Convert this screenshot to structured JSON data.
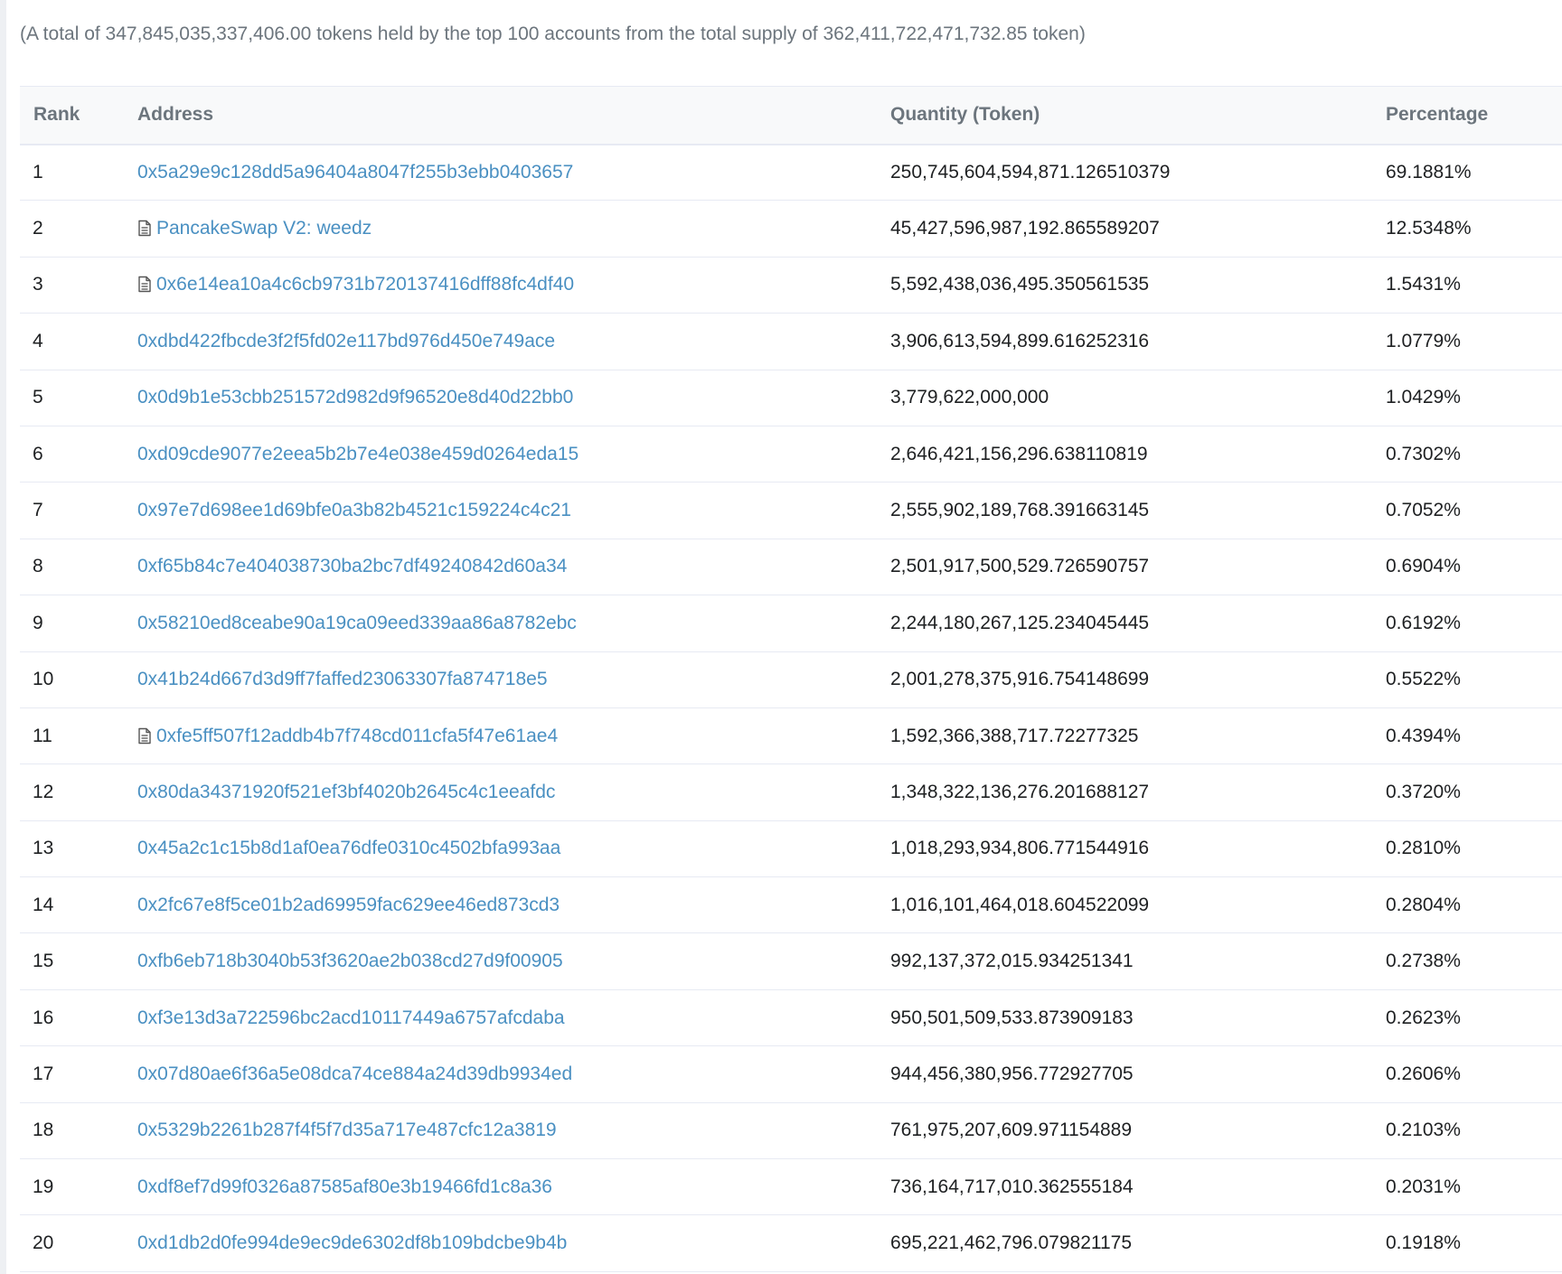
{
  "summary": {
    "text": "(A total of 347,845,035,337,406.00 tokens held by the top 100 accounts from the total supply of 362,411,722,471,732.85 token)"
  },
  "table": {
    "headers": {
      "rank": "Rank",
      "address": "Address",
      "quantity": "Quantity (Token)",
      "percentage": "Percentage"
    },
    "rows": [
      {
        "rank": "1",
        "address": "0x5a29e9c128dd5a96404a8047f255b3ebb0403657",
        "contract": false,
        "quantity": "250,745,604,594,871.126510379",
        "percentage": "69.1881%"
      },
      {
        "rank": "2",
        "address": "PancakeSwap V2: weedz",
        "contract": true,
        "quantity": "45,427,596,987,192.865589207",
        "percentage": "12.5348%"
      },
      {
        "rank": "3",
        "address": "0x6e14ea10a4c6cb9731b720137416dff88fc4df40",
        "contract": true,
        "quantity": "5,592,438,036,495.350561535",
        "percentage": "1.5431%"
      },
      {
        "rank": "4",
        "address": "0xdbd422fbcde3f2f5fd02e117bd976d450e749ace",
        "contract": false,
        "quantity": "3,906,613,594,899.616252316",
        "percentage": "1.0779%"
      },
      {
        "rank": "5",
        "address": "0x0d9b1e53cbb251572d982d9f96520e8d40d22bb0",
        "contract": false,
        "quantity": "3,779,622,000,000",
        "percentage": "1.0429%"
      },
      {
        "rank": "6",
        "address": "0xd09cde9077e2eea5b2b7e4e038e459d0264eda15",
        "contract": false,
        "quantity": "2,646,421,156,296.638110819",
        "percentage": "0.7302%"
      },
      {
        "rank": "7",
        "address": "0x97e7d698ee1d69bfe0a3b82b4521c159224c4c21",
        "contract": false,
        "quantity": "2,555,902,189,768.391663145",
        "percentage": "0.7052%"
      },
      {
        "rank": "8",
        "address": "0xf65b84c7e404038730ba2bc7df49240842d60a34",
        "contract": false,
        "quantity": "2,501,917,500,529.726590757",
        "percentage": "0.6904%"
      },
      {
        "rank": "9",
        "address": "0x58210ed8ceabe90a19ca09eed339aa86a8782ebc",
        "contract": false,
        "quantity": "2,244,180,267,125.234045445",
        "percentage": "0.6192%"
      },
      {
        "rank": "10",
        "address": "0x41b24d667d3d9ff7faffed23063307fa874718e5",
        "contract": false,
        "quantity": "2,001,278,375,916.754148699",
        "percentage": "0.5522%"
      },
      {
        "rank": "11",
        "address": "0xfe5ff507f12addb4b7f748cd011cfa5f47e61ae4",
        "contract": true,
        "quantity": "1,592,366,388,717.72277325",
        "percentage": "0.4394%"
      },
      {
        "rank": "12",
        "address": "0x80da34371920f521ef3bf4020b2645c4c1eeafdc",
        "contract": false,
        "quantity": "1,348,322,136,276.201688127",
        "percentage": "0.3720%"
      },
      {
        "rank": "13",
        "address": "0x45a2c1c15b8d1af0ea76dfe0310c4502bfa993aa",
        "contract": false,
        "quantity": "1,018,293,934,806.771544916",
        "percentage": "0.2810%"
      },
      {
        "rank": "14",
        "address": "0x2fc67e8f5ce01b2ad69959fac629ee46ed873cd3",
        "contract": false,
        "quantity": "1,016,101,464,018.604522099",
        "percentage": "0.2804%"
      },
      {
        "rank": "15",
        "address": "0xfb6eb718b3040b53f3620ae2b038cd27d9f00905",
        "contract": false,
        "quantity": "992,137,372,015.934251341",
        "percentage": "0.2738%"
      },
      {
        "rank": "16",
        "address": "0xf3e13d3a722596bc2acd10117449a6757afcdaba",
        "contract": false,
        "quantity": "950,501,509,533.873909183",
        "percentage": "0.2623%"
      },
      {
        "rank": "17",
        "address": "0x07d80ae6f36a5e08dca74ce884a24d39db9934ed",
        "contract": false,
        "quantity": "944,456,380,956.772927705",
        "percentage": "0.2606%"
      },
      {
        "rank": "18",
        "address": "0x5329b2261b287f4f5f7d35a717e487cfc12a3819",
        "contract": false,
        "quantity": "761,975,207,609.971154889",
        "percentage": "0.2103%"
      },
      {
        "rank": "19",
        "address": "0xdf8ef7d99f0326a87585af80e3b19466fd1c8a36",
        "contract": false,
        "quantity": "736,164,717,010.362555184",
        "percentage": "0.2031%"
      },
      {
        "rank": "20",
        "address": "0xd1db2d0fe994de9ec9de6302df8b109bdcbe9b4b",
        "contract": false,
        "quantity": "695,221,462,796.079821175",
        "percentage": "0.1918%"
      }
    ]
  },
  "icons": {
    "contract": "file-contract-icon"
  },
  "colors": {
    "link": "#4a90c2",
    "muted_text": "#6c757d",
    "header_bg": "#f8f9fa",
    "row_border": "#e7eaf3"
  }
}
